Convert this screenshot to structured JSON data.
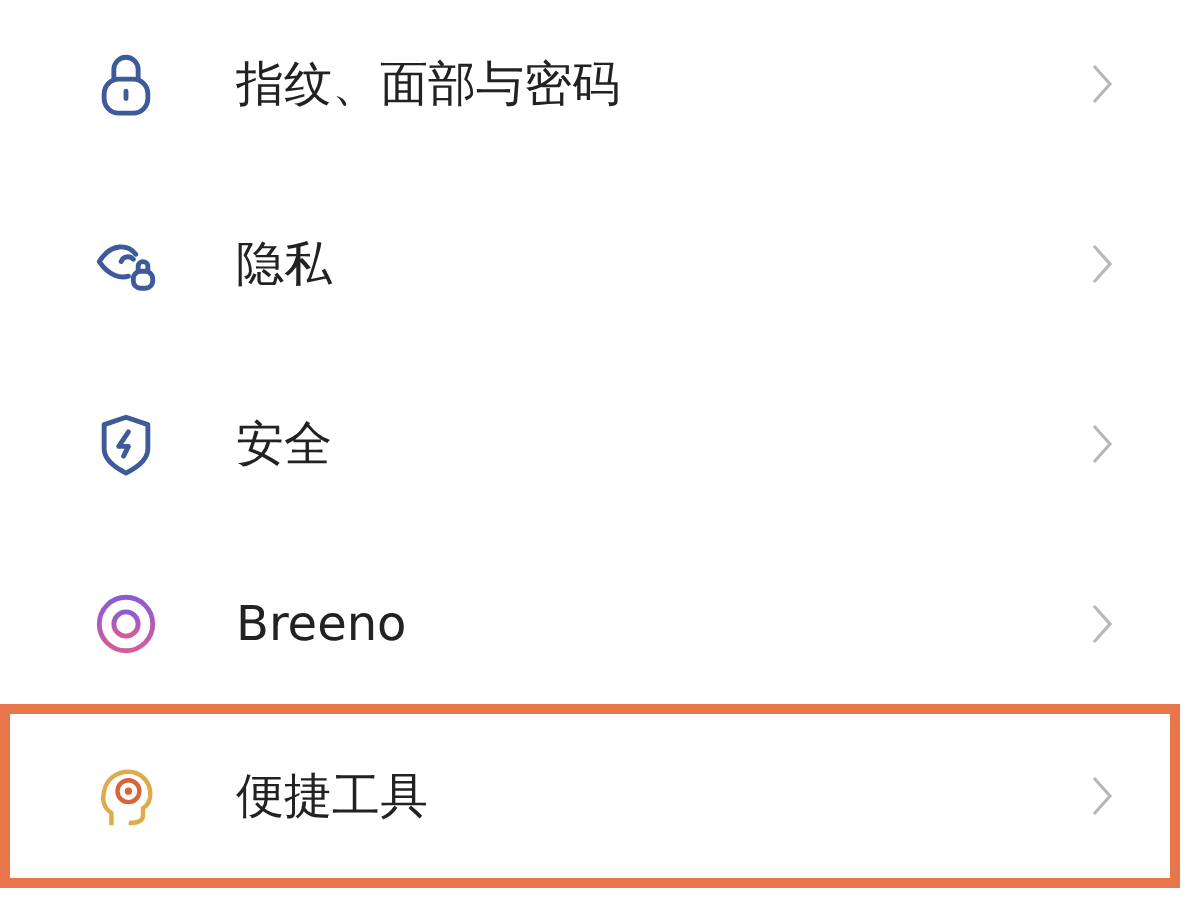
{
  "items": [
    {
      "kind": "lock",
      "label": "指纹、面部与密码",
      "highlighted": false
    },
    {
      "kind": "privacy",
      "label": "隐私",
      "highlighted": false
    },
    {
      "kind": "shield",
      "label": "安全",
      "highlighted": false
    },
    {
      "kind": "ring",
      "label": "Breeno",
      "highlighted": false
    },
    {
      "kind": "head",
      "label": "便捷工具",
      "highlighted": true
    }
  ]
}
